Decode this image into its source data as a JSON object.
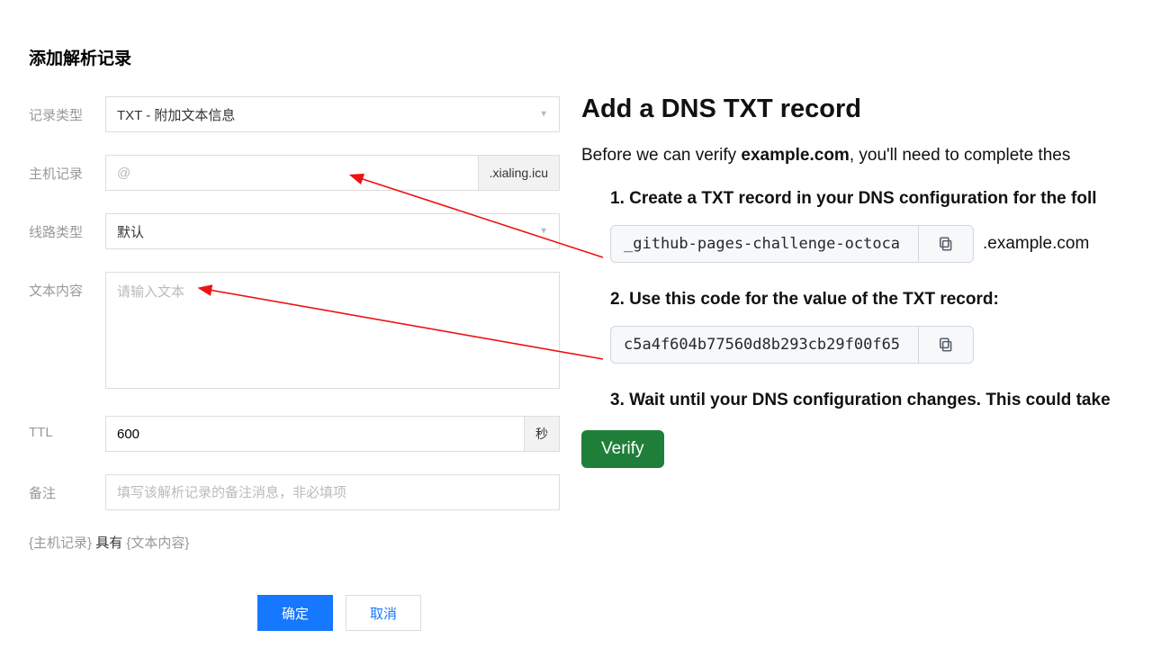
{
  "form": {
    "title": "添加解析记录",
    "labels": {
      "record_type": "记录类型",
      "host_record": "主机记录",
      "line_type": "线路类型",
      "text_content": "文本内容",
      "ttl": "TTL",
      "remark": "备注"
    },
    "record_type_value": "TXT - 附加文本信息",
    "host_placeholder": "@",
    "host_suffix": ".xialing.icu",
    "line_type_value": "默认",
    "text_placeholder": "请输入文本",
    "ttl_value": "600",
    "ttl_unit": "秒",
    "remark_placeholder": "填写该解析记录的备注消息，非必填项",
    "summary_pre": "{主机记录}",
    "summary_mid": " 具有 ",
    "summary_post": "{文本内容}",
    "confirm": "确定",
    "cancel": "取消"
  },
  "right": {
    "title": "Add a DNS TXT record",
    "intro_pre": "Before we can verify ",
    "intro_bold": "example.com",
    "intro_post": ", you'll need to complete thes",
    "step1": "1. Create a TXT record in your DNS configuration for the foll",
    "code1": "_github-pages-challenge-octoca",
    "suffix1": ".example.com",
    "step2": "2. Use this code for the value of the TXT record:",
    "code2": "c5a4f604b77560d8b293cb29f00f65",
    "step3": "3. Wait until your DNS configuration changes. This could take",
    "verify": "Verify"
  }
}
